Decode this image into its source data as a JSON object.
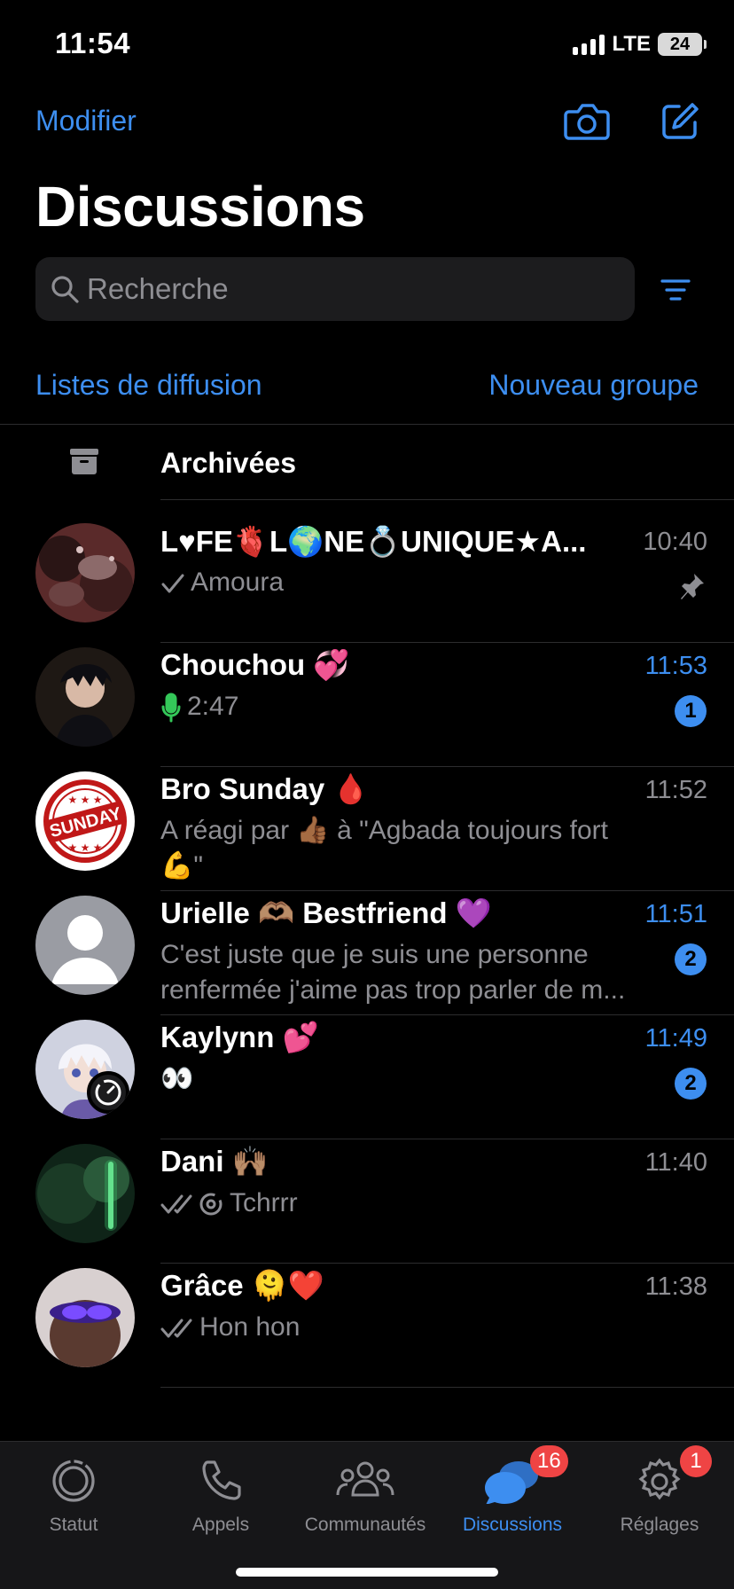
{
  "status_bar": {
    "time": "11:54",
    "network": "LTE",
    "battery": "24"
  },
  "header": {
    "edit_label": "Modifier",
    "title": "Discussions",
    "camera_icon": "camera-icon",
    "compose_icon": "compose-icon"
  },
  "search": {
    "placeholder": "Recherche",
    "filter_icon": "filter-icon"
  },
  "links": {
    "broadcast": "Listes de diffusion",
    "new_group": "Nouveau groupe"
  },
  "archived": {
    "label": "Archivées",
    "icon": "archive-box-icon"
  },
  "chats": [
    {
      "name": "L♥FE🫀L🌍NE💍UNIQUE★A...",
      "time": "10:40",
      "preview": "Amoura",
      "status": "single-check",
      "pinned": true,
      "unread": null,
      "unread_time": false,
      "avatar": "group-photo"
    },
    {
      "name": "Chouchou 💞",
      "time": "11:53",
      "preview": "2:47",
      "status": "mic",
      "pinned": false,
      "unread": "1",
      "unread_time": true,
      "avatar": "anime-boy"
    },
    {
      "name": "Bro Sunday 🩸",
      "time": "11:52",
      "preview": "A réagi par 👍🏾 à \"Agbada toujours fort 💪\"",
      "status": null,
      "pinned": false,
      "unread": null,
      "unread_time": false,
      "avatar": "sunday-stamp"
    },
    {
      "name": "Urielle 🫶🏽 Bestfriend 💜",
      "time": "11:51",
      "preview": "C'est juste que je suis une personne renfermée j'aime pas trop parler de m...",
      "status": null,
      "pinned": false,
      "unread": "2",
      "unread_time": true,
      "avatar": "default-person"
    },
    {
      "name": "Kaylynn 💕",
      "time": "11:49",
      "preview": "👀",
      "status": null,
      "pinned": false,
      "unread": "2",
      "unread_time": true,
      "avatar": "anime-white-hair"
    },
    {
      "name": "Dani 🙌🏽",
      "time": "11:40",
      "preview": "Tchrrr",
      "status": "double-check-timer",
      "pinned": false,
      "unread": null,
      "unread_time": false,
      "avatar": "green-light"
    },
    {
      "name": "Grâce 🫠❤️",
      "time": "11:38",
      "preview": "Hon hon",
      "status": "double-check",
      "pinned": false,
      "unread": null,
      "unread_time": false,
      "avatar": "purple-glasses"
    }
  ],
  "tabs": [
    {
      "label": "Statut",
      "icon": "status-ring-icon",
      "active": false,
      "badge": null
    },
    {
      "label": "Appels",
      "icon": "phone-icon",
      "active": false,
      "badge": null
    },
    {
      "label": "Communautés",
      "icon": "communities-icon",
      "active": false,
      "badge": null
    },
    {
      "label": "Discussions",
      "icon": "chat-bubbles-icon",
      "active": true,
      "badge": "16"
    },
    {
      "label": "Réglages",
      "icon": "gear-icon",
      "active": false,
      "badge": "1"
    }
  ],
  "colors": {
    "accent": "#3d8ef0",
    "background": "#000000",
    "muted": "#8e8e93",
    "badge_red": "#ef4444",
    "mic_green": "#34c759"
  }
}
